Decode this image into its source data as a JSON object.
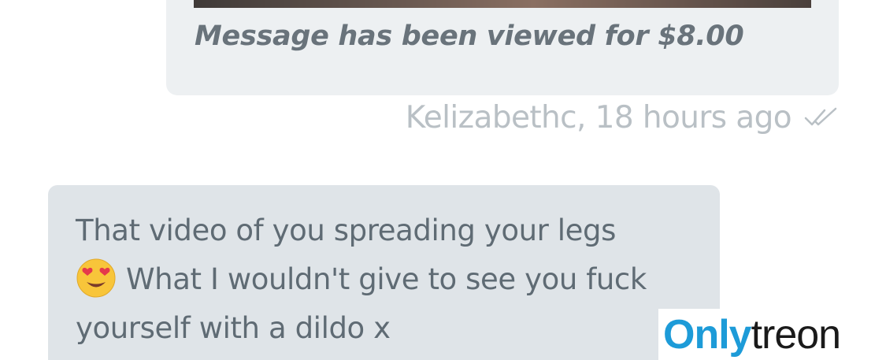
{
  "sent_message": {
    "viewed_text": "Message has been viewed for $8.00",
    "sender_meta": "Kelizabethc, 18 hours ago",
    "read_status_icon": "double-check-icon"
  },
  "received_message": {
    "lines": [
      "That video of you spreading your legs",
      "What I wouldn't give to see you fuck",
      "yourself with a dildo x"
    ],
    "emoji": "heart-eyes-emoji"
  },
  "watermark": {
    "part1": "Only",
    "part2": "treon"
  },
  "colors": {
    "sent_bubble": "#edf0f2",
    "received_bubble": "#dfe4e8",
    "meta_text": "#b9c0c5",
    "brand_blue": "#1d9bd8"
  }
}
